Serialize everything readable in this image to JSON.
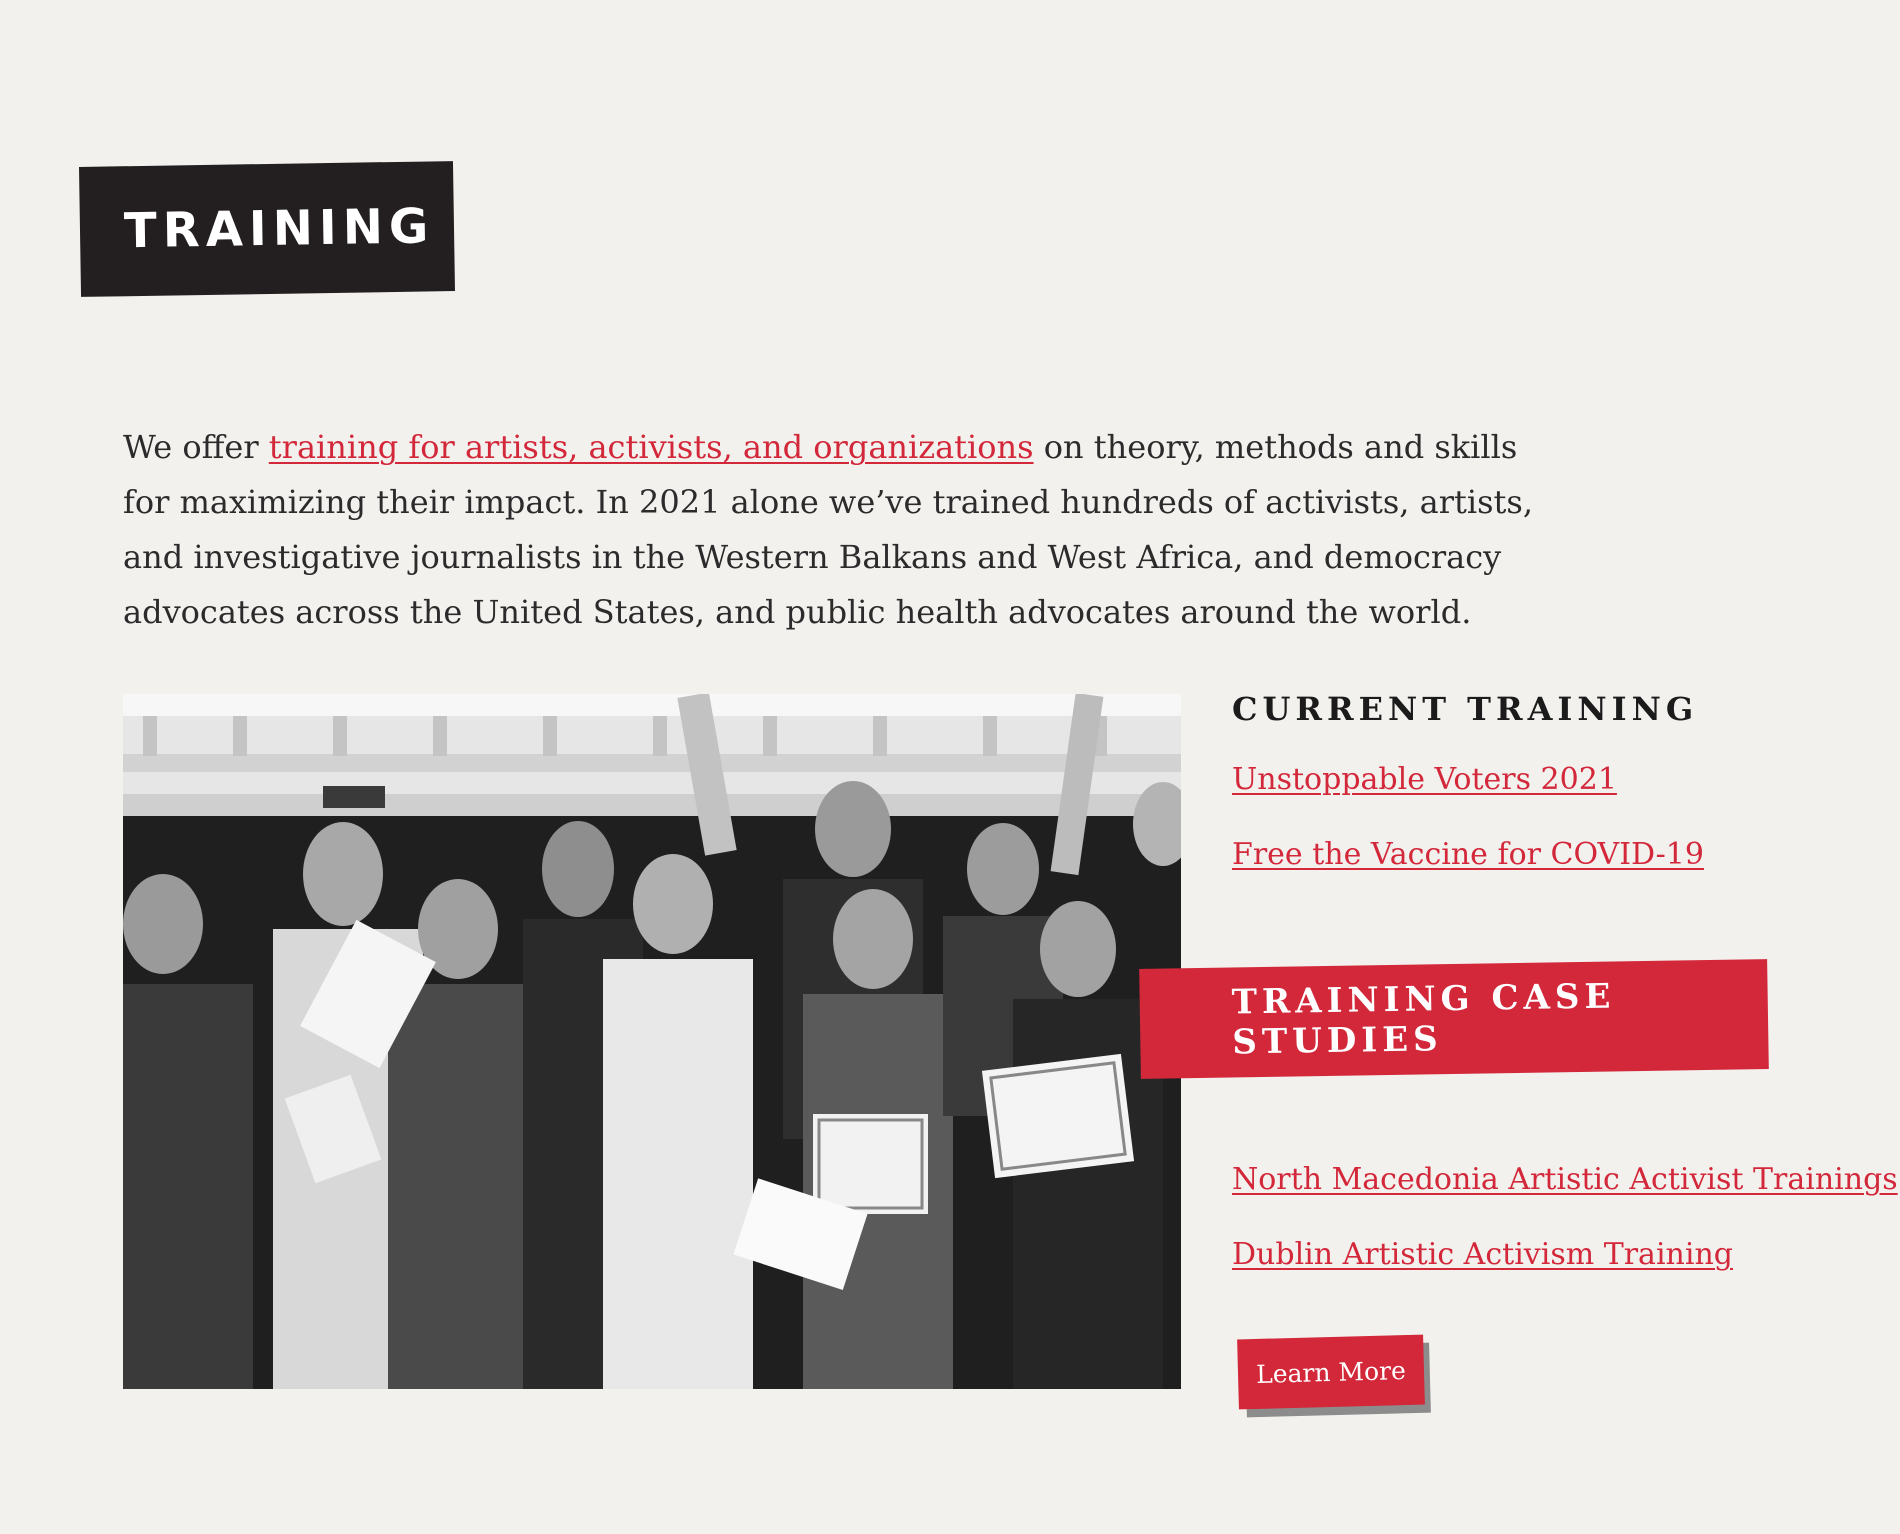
{
  "section": {
    "title": "TRAINING"
  },
  "intro": {
    "before_link": "We offer ",
    "link_text": "training for artists, activists, and organizations",
    "after_link": " on theory, methods and skills for maximizing their impact. In 2021 alone we’ve trained hundreds of activists, artists, and investigative journalists in the Western Balkans and West Africa, and democracy advocates across the United States, and public health advocates around the world."
  },
  "current_training": {
    "heading": "CURRENT TRAINING",
    "links": [
      "Unstoppable Voters 2021",
      "Free the Vaccine for COVID-19"
    ]
  },
  "case_studies": {
    "heading": "TRAINING CASE STUDIES",
    "links": [
      "North Macedonia Artistic Activist Trainings",
      "Dublin Artistic Activism Training"
    ]
  },
  "learn_more": {
    "label": "Learn More"
  },
  "colors": {
    "background": "#f3f1ee",
    "accent_red": "#d3273a",
    "dark": "#231f20"
  }
}
